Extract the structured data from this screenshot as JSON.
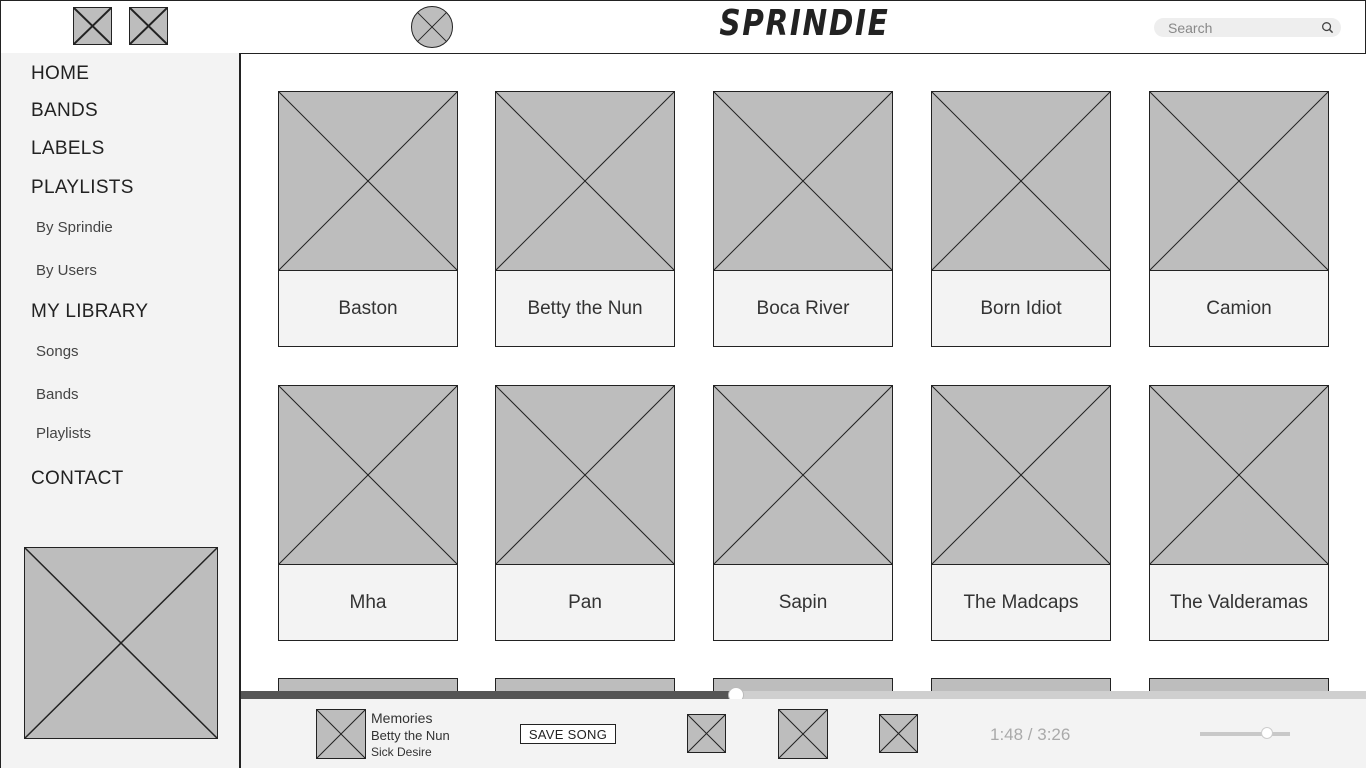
{
  "app": {
    "logo": "SPRINDIE"
  },
  "header": {
    "icons": [
      "image-placeholder-icon",
      "image-placeholder-icon",
      "avatar-placeholder-icon"
    ],
    "search": {
      "placeholder": "Search",
      "value": ""
    }
  },
  "sidebar": {
    "home": "HOME",
    "bands": "BANDS",
    "labels": "LABELS",
    "playlists": "PLAYLISTS",
    "by_sprindie": "By Sprindie",
    "by_users": "By Users",
    "my_library": "MY LIBRARY",
    "songs": "Songs",
    "lib_bands": "Bands",
    "lib_playlists": "Playlists",
    "contact": "CONTACT"
  },
  "bands": [
    "Baston",
    "Betty the Nun",
    "Boca River",
    "Born Idiot",
    "Camion",
    "Mha",
    "Pan",
    "Sapin",
    "The Madcaps",
    "The Valderamas"
  ],
  "player": {
    "title": "Memories",
    "artist": "Betty the Nun",
    "album": "Sick Desire",
    "save_label": "SAVE SONG",
    "time": "1:48 / 3:26",
    "progress": 0.44,
    "volume": 0.74
  },
  "colors": {
    "placeholder": "#bdbdbd",
    "panel": "#f3f3f3",
    "border": "#222222",
    "progress_fill": "#555555"
  }
}
